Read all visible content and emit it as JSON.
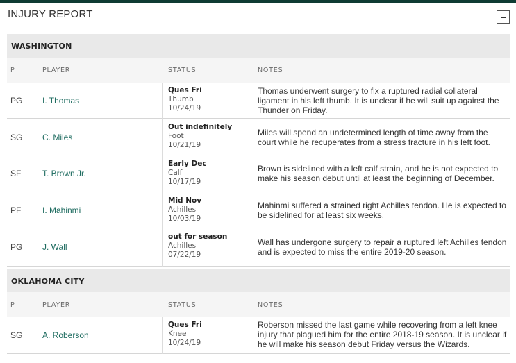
{
  "page": {
    "title": "INJURY REPORT",
    "collapse_label": "-"
  },
  "columns": {
    "pos": "P",
    "player": "PLAYER",
    "status": "STATUS",
    "notes": "NOTES"
  },
  "teams": [
    {
      "name": "WASHINGTON",
      "players": [
        {
          "pos": "PG",
          "player": "I. Thomas",
          "status": "Ques Fri",
          "injury": "Thumb",
          "date": "10/24/19",
          "notes": "Thomas underwent surgery to fix a ruptured radial collateral ligament in his left thumb. It is unclear if he will suit up against the Thunder on Friday."
        },
        {
          "pos": "SG",
          "player": "C. Miles",
          "status": "Out indefinitely",
          "injury": "Foot",
          "date": "10/21/19",
          "notes": "Miles will spend an undetermined length of time away from the court while he recuperates from a stress fracture in his left foot."
        },
        {
          "pos": "SF",
          "player": "T. Brown Jr.",
          "status": "Early Dec",
          "injury": "Calf",
          "date": "10/17/19",
          "notes": "Brown is sidelined with a left calf strain, and he is not expected to make his season debut until at least the beginning of December."
        },
        {
          "pos": "PF",
          "player": "I. Mahinmi",
          "status": "Mid Nov",
          "injury": "Achilles",
          "date": "10/03/19",
          "notes": "Mahinmi suffered a strained right Achilles tendon. He is expected to be sidelined for at least six weeks."
        },
        {
          "pos": "PG",
          "player": "J. Wall",
          "status": "out for season",
          "injury": "Achilles",
          "date": "07/22/19",
          "notes": "Wall has undergone surgery to repair a ruptured left Achilles tendon and is expected to miss the entire 2019-20 season."
        }
      ]
    },
    {
      "name": "OKLAHOMA CITY",
      "players": [
        {
          "pos": "SG",
          "player": "A. Roberson",
          "status": "Ques Fri",
          "injury": "Knee",
          "date": "10/24/19",
          "notes": "Roberson missed the last game while recovering from a left knee injury that plagued him for the entire 2018-19 season. It is unclear if he will make his season debut Friday versus the Wizards."
        }
      ]
    }
  ],
  "colors": {
    "top_bar": "#0f3b33",
    "player_link": "#1d6b5f",
    "team_header_bg": "#e9e9e9",
    "column_header_bg": "#f5f5f5"
  }
}
